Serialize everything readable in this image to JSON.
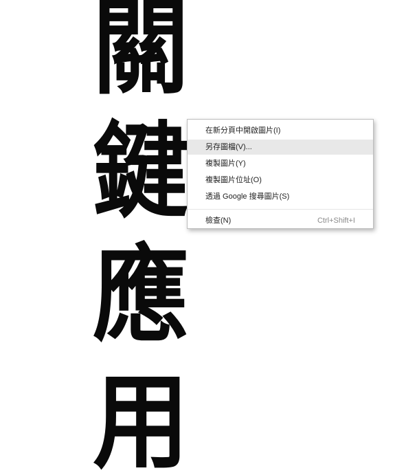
{
  "calligraphy": {
    "characters": [
      "關",
      "鍵",
      "應",
      "用"
    ]
  },
  "context_menu": {
    "items": [
      {
        "label": "在新分頁中開啟圖片(I)",
        "hovered": false
      },
      {
        "label": "另存圖檔(V)...",
        "hovered": true
      },
      {
        "label": "複製圖片(Y)",
        "hovered": false
      },
      {
        "label": "複製圖片位址(O)",
        "hovered": false
      },
      {
        "label": "透過 Google 搜尋圖片(S)",
        "hovered": false
      }
    ],
    "inspect": {
      "label": "檢查(N)",
      "shortcut": "Ctrl+Shift+I"
    }
  },
  "colors": {
    "ink": "#0a0a0a",
    "menu_hover": "#e8e8e8",
    "menu_border": "#bdbdbd",
    "shortcut_text": "#8a8a8a"
  }
}
